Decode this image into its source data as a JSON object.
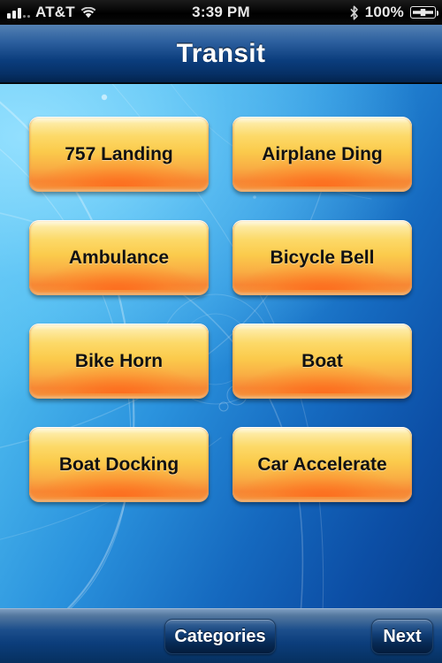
{
  "statusbar": {
    "signal_icon": "signal-bars-icon",
    "carrier": "AT&T",
    "wifi_icon": "wifi-icon",
    "time": "3:39 PM",
    "bluetooth_icon": "bluetooth-icon",
    "battery_percent": "100%",
    "battery_icon": "battery-charging-icon"
  },
  "navbar": {
    "title": "Transit"
  },
  "sounds": [
    {
      "label": "757 Landing"
    },
    {
      "label": "Airplane Ding"
    },
    {
      "label": "Ambulance"
    },
    {
      "label": "Bicycle Bell"
    },
    {
      "label": "Bike Horn"
    },
    {
      "label": "Boat"
    },
    {
      "label": "Boat Docking"
    },
    {
      "label": "Car Accelerate"
    }
  ],
  "toolbar": {
    "categories_label": "Categories",
    "next_label": "Next"
  },
  "colors": {
    "button_top": "#fffdf2",
    "button_mid": "#fbcb4c",
    "button_bottom": "#f78734",
    "navbar_top": "#5481b3",
    "navbar_bottom": "#03244e",
    "background_light": "#69cdf4",
    "background_dark": "#073f8e",
    "toolbar_button": "#123f77"
  }
}
